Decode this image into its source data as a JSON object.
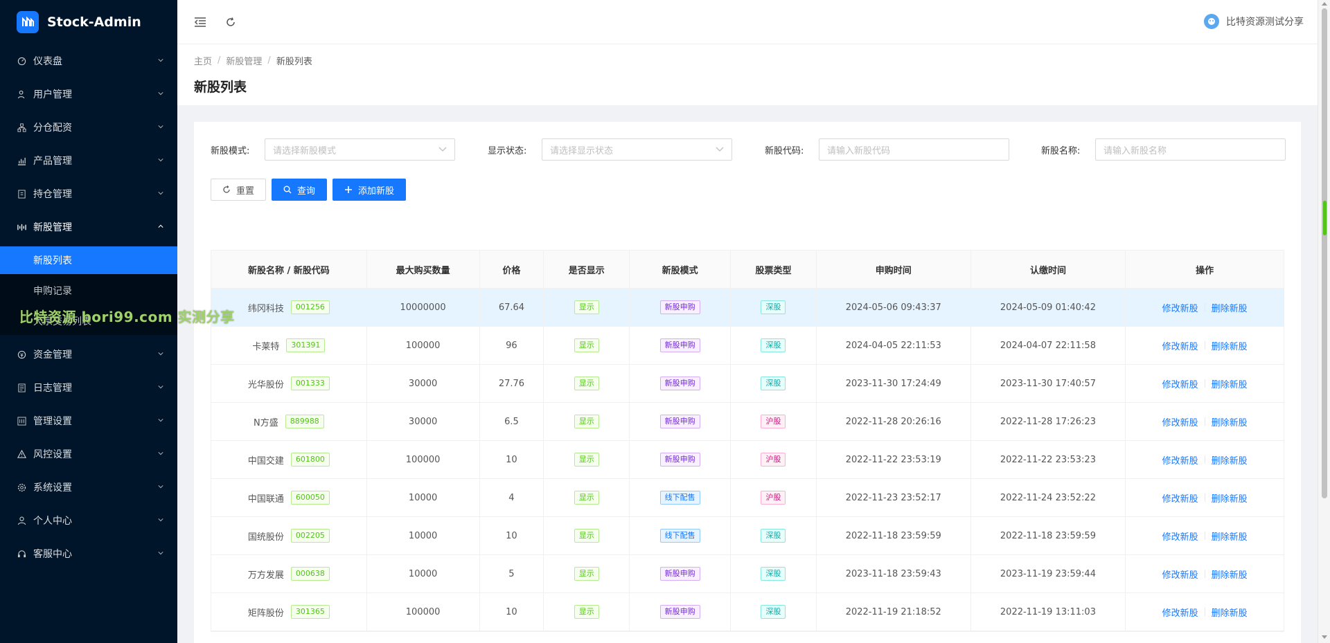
{
  "app": {
    "title": "Stock-Admin"
  },
  "sidebar": {
    "items": [
      {
        "label": "仪表盘",
        "icon": "dashboard-icon",
        "name": "dashboard"
      },
      {
        "label": "用户管理",
        "icon": "user-manage-icon",
        "name": "user-management"
      },
      {
        "label": "分仓配资",
        "icon": "allocation-icon",
        "name": "allocation"
      },
      {
        "label": "产品管理",
        "icon": "chart-icon",
        "name": "product-management"
      },
      {
        "label": "持仓管理",
        "icon": "position-icon",
        "name": "position-management"
      },
      {
        "label": "新股管理",
        "icon": "ipo-icon",
        "name": "ipo-management",
        "open": true
      },
      {
        "label": "资金管理",
        "icon": "money-icon",
        "name": "fund-management"
      },
      {
        "label": "日志管理",
        "icon": "log-icon",
        "name": "log-management"
      },
      {
        "label": "管理设置",
        "icon": "admin-settings-icon",
        "name": "admin-settings"
      },
      {
        "label": "风控设置",
        "icon": "warning-icon",
        "name": "risk-settings"
      },
      {
        "label": "系统设置",
        "icon": "gear-icon",
        "name": "system-settings"
      },
      {
        "label": "个人中心",
        "icon": "person-icon",
        "name": "personal-center"
      },
      {
        "label": "客服中心",
        "icon": "headset-icon",
        "name": "service-center"
      }
    ],
    "submenu": [
      {
        "label": "新股列表",
        "active": true
      },
      {
        "label": "申购记录",
        "active": false
      },
      {
        "label": "大宗交易列表",
        "active": false
      }
    ]
  },
  "watermark": "比特资源 bori99.com 实测分享",
  "header": {
    "user_name": "比特资源测试分享"
  },
  "breadcrumb": [
    "主页",
    "新股管理",
    "新股列表"
  ],
  "page_title": "新股列表",
  "filters": [
    {
      "label": "新股模式:",
      "placeholder": "请选择新股模式",
      "type": "select"
    },
    {
      "label": "显示状态:",
      "placeholder": "请选择显示状态",
      "type": "select"
    },
    {
      "label": "新股代码:",
      "placeholder": "请输入新股代码",
      "type": "input"
    },
    {
      "label": "新股名称:",
      "placeholder": "请输入新股名称",
      "type": "input"
    }
  ],
  "buttons": {
    "reset": "重置",
    "search": "查询",
    "add": "添加新股"
  },
  "table": {
    "columns": [
      "新股名称 / 新股代码",
      "最大购买数量",
      "价格",
      "是否显示",
      "新股模式",
      "股票类型",
      "申购时间",
      "认缴时间",
      "操作"
    ],
    "actions": {
      "edit": "修改新股",
      "delete": "删除新股"
    },
    "rows": [
      {
        "name": "纬冈科技",
        "code": "001256",
        "max_qty": "10000000",
        "price": "67.64",
        "show": "显示",
        "mode": "新股申购",
        "type": "深股",
        "subscribe_time": "2024-05-06 09:43:37",
        "pay_time": "2024-05-09 01:40:42"
      },
      {
        "name": "卡莱特",
        "code": "301391",
        "max_qty": "100000",
        "price": "96",
        "show": "显示",
        "mode": "新股申购",
        "type": "深股",
        "subscribe_time": "2024-04-05 22:11:53",
        "pay_time": "2024-04-07 22:11:58"
      },
      {
        "name": "光华股份",
        "code": "001333",
        "max_qty": "30000",
        "price": "27.76",
        "show": "显示",
        "mode": "新股申购",
        "type": "深股",
        "subscribe_time": "2023-11-30 17:24:49",
        "pay_time": "2023-11-30 17:40:57"
      },
      {
        "name": "N方盛",
        "code": "889988",
        "max_qty": "30000",
        "price": "6.5",
        "show": "显示",
        "mode": "新股申购",
        "type": "沪股",
        "subscribe_time": "2022-11-28 20:26:16",
        "pay_time": "2022-11-28 17:26:23"
      },
      {
        "name": "中国交建",
        "code": "601800",
        "max_qty": "100000",
        "price": "10",
        "show": "显示",
        "mode": "新股申购",
        "type": "沪股",
        "subscribe_time": "2022-11-22 23:53:19",
        "pay_time": "2022-11-22 23:53:23"
      },
      {
        "name": "中国联通",
        "code": "600050",
        "max_qty": "10000",
        "price": "4",
        "show": "显示",
        "mode": "线下配售",
        "type": "沪股",
        "subscribe_time": "2022-11-23 23:52:17",
        "pay_time": "2022-11-24 23:52:22"
      },
      {
        "name": "国统股份",
        "code": "002205",
        "max_qty": "10000",
        "price": "10",
        "show": "显示",
        "mode": "线下配售",
        "type": "深股",
        "subscribe_time": "2022-11-18 23:59:59",
        "pay_time": "2022-11-18 23:59:59"
      },
      {
        "name": "万方发展",
        "code": "000638",
        "max_qty": "10000",
        "price": "5",
        "show": "显示",
        "mode": "新股申购",
        "type": "深股",
        "subscribe_time": "2023-11-18 23:59:43",
        "pay_time": "2023-11-19 23:59:44"
      },
      {
        "name": "矩阵股份",
        "code": "301365",
        "max_qty": "100000",
        "price": "10",
        "show": "显示",
        "mode": "新股申购",
        "type": "深股",
        "subscribe_time": "2022-11-19 21:18:52",
        "pay_time": "2022-11-19 13:11:03"
      }
    ]
  },
  "colors": {
    "primary": "#1677ff",
    "sidebar_bg": "#001529",
    "submenu_bg": "#000c17",
    "watermark": "#9fd16b"
  }
}
